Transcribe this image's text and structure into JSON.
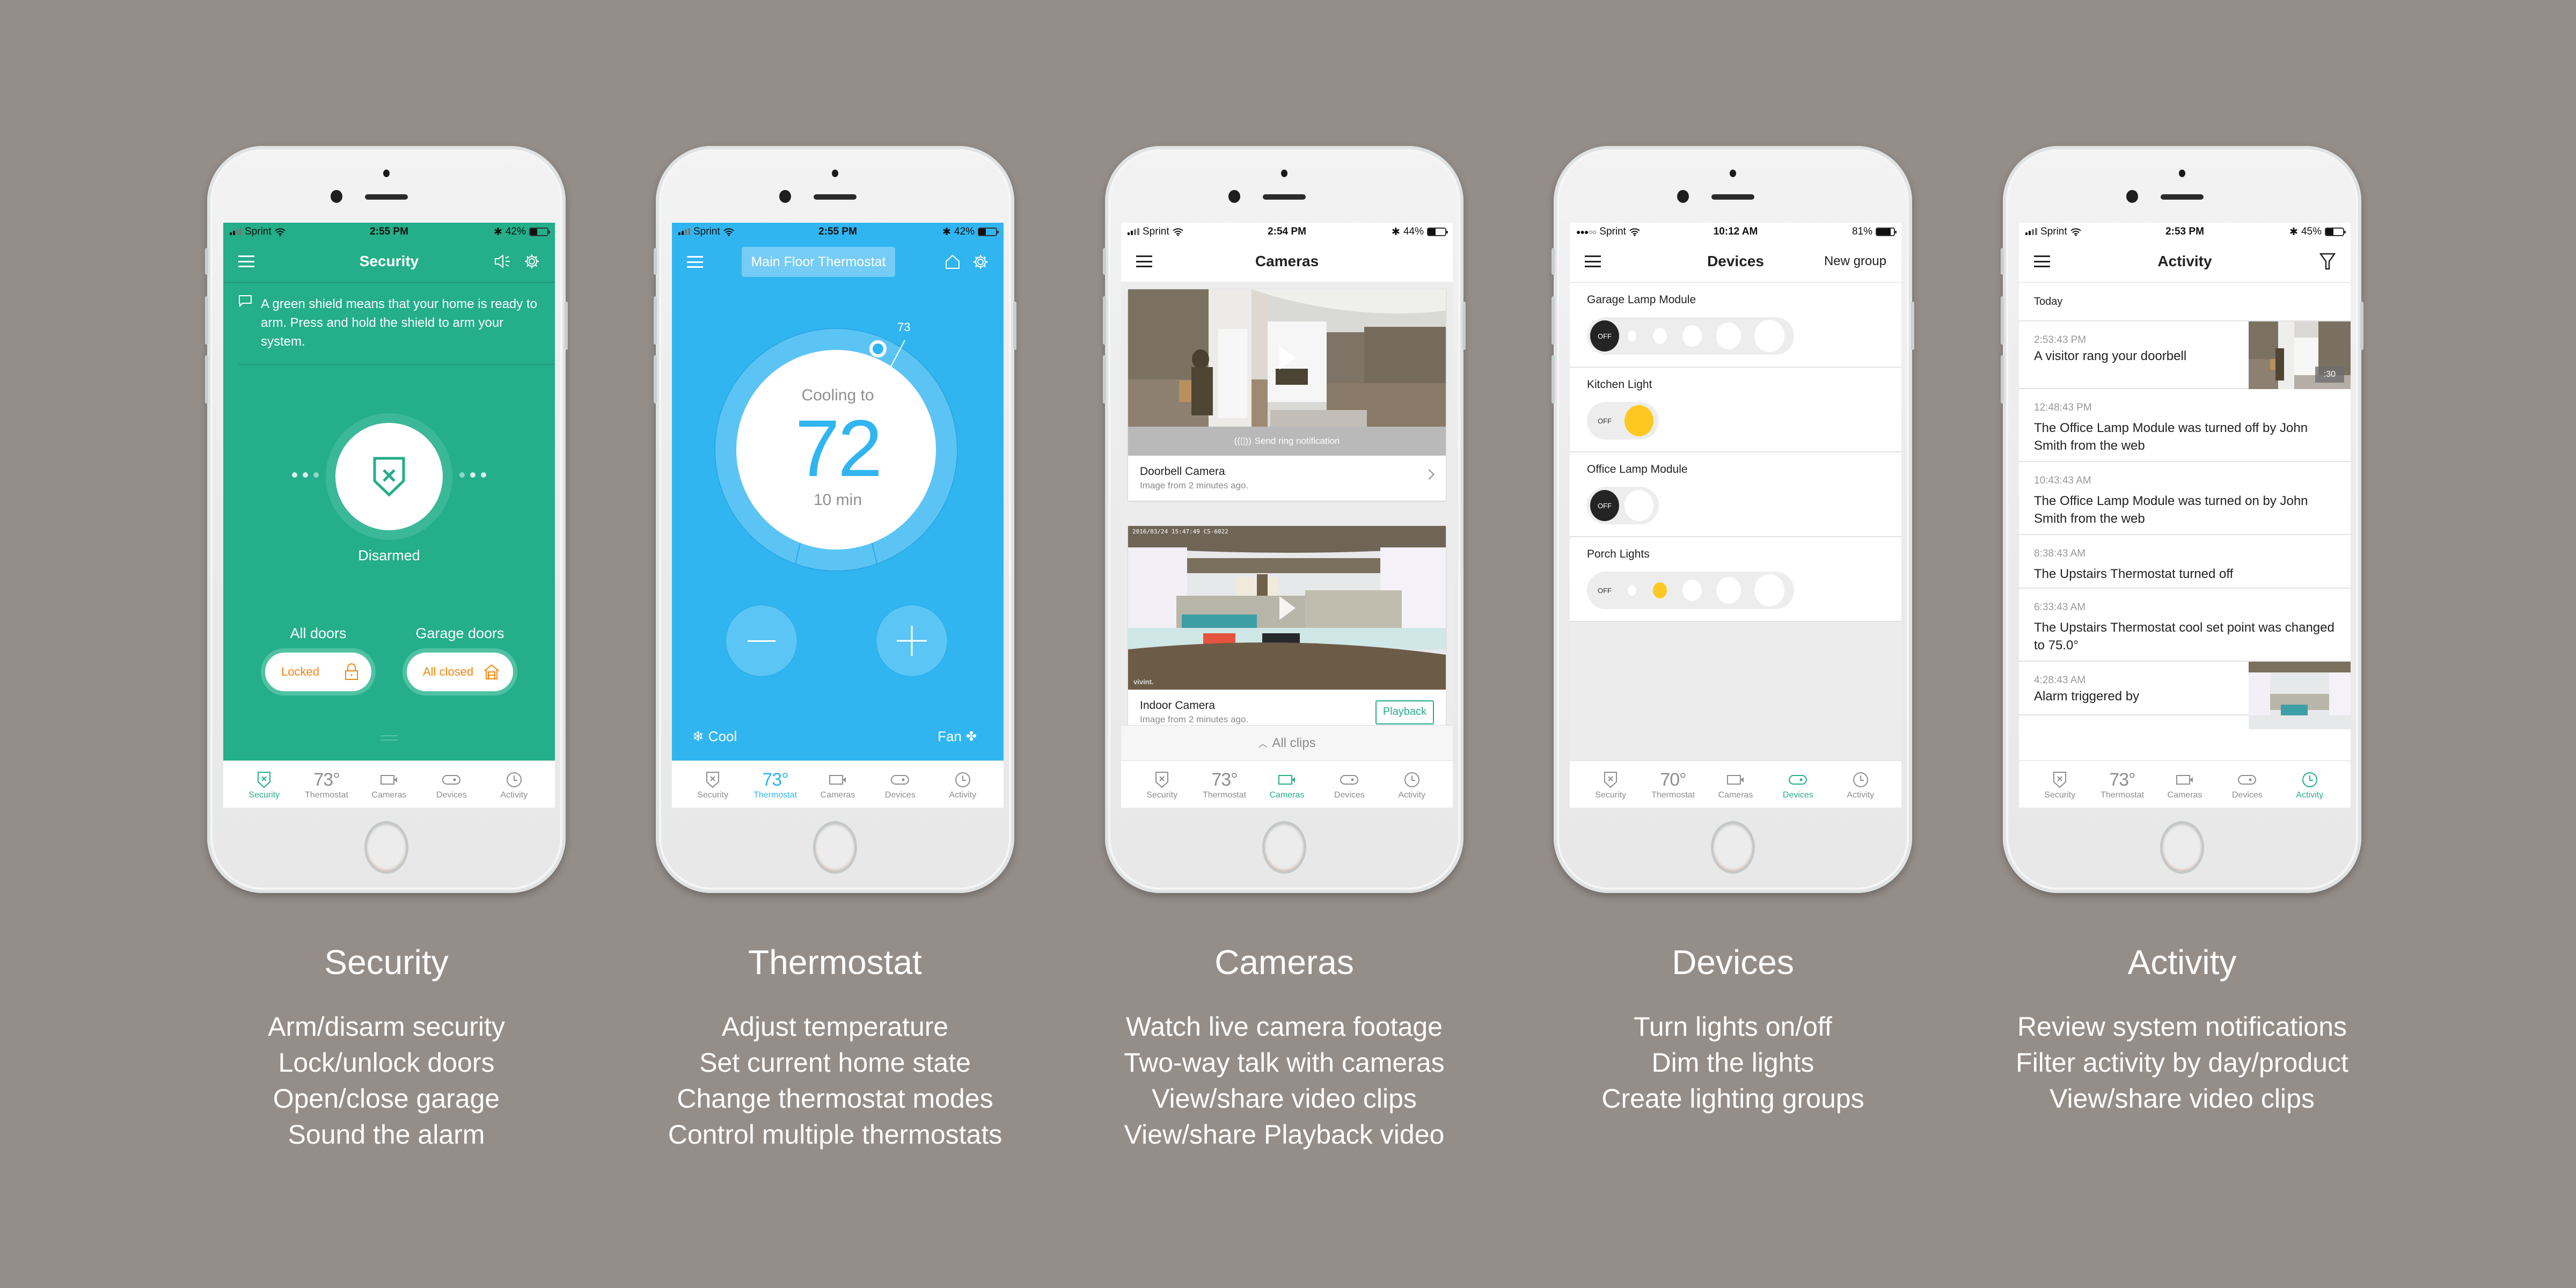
{
  "colors": {
    "background": "#958d88",
    "security_green": "#24ae8a",
    "thermostat_blue": "#31b5f1",
    "accent_orange": "#f6850b",
    "dimmer_yellow": "#fdc822",
    "tab_inactive": "#8e8e8e"
  },
  "tabbar_labels": [
    "Security",
    "Thermostat",
    "Cameras",
    "Devices",
    "Activity"
  ],
  "panels": [
    {
      "caption": {
        "title": "Security",
        "features": [
          "Arm/disarm security",
          "Lock/unlock doors",
          "Open/close garage",
          "Sound the alarm"
        ]
      },
      "status": {
        "carrier": "Sprint",
        "time": "2:55 PM",
        "battery": "42%",
        "battery_level": 0.42,
        "bluetooth": true
      },
      "header": {
        "title": "Security",
        "icons": [
          "menu-icon",
          "panic-alarm-icon",
          "gear-icon"
        ]
      },
      "hint": "A green shield means that your home is ready to arm. Press and hold the shield to arm your system.",
      "arm_state": "Disarmed",
      "doors": [
        {
          "label": "All doors",
          "status": "Locked",
          "icon": "lock-icon"
        },
        {
          "label": "Garage doors",
          "status": "All closed",
          "icon": "garage-icon"
        }
      ],
      "tabbar": {
        "thermostat_temp": "73°",
        "active": "Security"
      }
    },
    {
      "caption": {
        "title": "Thermostat",
        "features": [
          "Adjust temperature",
          "Set current home state",
          "Change thermostat modes",
          "Control multiple thermostats"
        ]
      },
      "status": {
        "carrier": "Sprint",
        "time": "2:55 PM",
        "battery": "42%",
        "battery_level": 0.42,
        "bluetooth": true
      },
      "header": {
        "title": "Main Floor Thermostat",
        "icons": [
          "menu-icon",
          "home-icon",
          "gear-icon"
        ]
      },
      "dial": {
        "label": "Cooling to",
        "setpoint": "72",
        "eta": "10 min",
        "current_temp": "73"
      },
      "mode": "Cool",
      "fan": "Fan",
      "tabbar": {
        "thermostat_temp": "73°",
        "active": "Thermostat"
      }
    },
    {
      "caption": {
        "title": "Cameras",
        "features": [
          "Watch live camera footage",
          "Two-way talk with cameras",
          "View/share video clips",
          "View/share Playback video"
        ]
      },
      "status": {
        "carrier": "Sprint",
        "time": "2:54 PM",
        "battery": "44%",
        "battery_level": 0.44,
        "bluetooth": true
      },
      "header": {
        "title": "Cameras"
      },
      "cameras": [
        {
          "name": "Doorbell Camera",
          "subtitle": "Image from 2 minutes ago.",
          "action": "Send ring notification"
        },
        {
          "name": "Indoor Camera",
          "subtitle": "Image from 2 minutes ago.",
          "button": "Playback",
          "overlay_timestamp": "2016/03/24 15:47:49 CS-6022",
          "watermark": "vivint."
        }
      ],
      "all_clips": "All clips",
      "tabbar": {
        "thermostat_temp": "73°",
        "active": "Cameras"
      }
    },
    {
      "caption": {
        "title": "Devices",
        "features": [
          "Turn lights on/off",
          "Dim the lights",
          "Create lighting groups"
        ]
      },
      "status": {
        "carrier": "Sprint",
        "time": "10:12 AM",
        "battery": "81%",
        "battery_level": 0.81,
        "bluetooth": false
      },
      "header": {
        "title": "Devices",
        "action": "New group"
      },
      "devices": [
        {
          "name": "Garage Lamp Module",
          "type": "dimmer",
          "levels": 5,
          "level": 0,
          "off_label": "OFF"
        },
        {
          "name": "Kitchen Light",
          "type": "switch",
          "on": true,
          "off_label": "OFF"
        },
        {
          "name": "Office Lamp Module",
          "type": "switch",
          "on": false,
          "off_label": "OFF"
        },
        {
          "name": "Porch Lights",
          "type": "dimmer",
          "levels": 5,
          "level": 2,
          "off_label": "OFF"
        }
      ],
      "tabbar": {
        "thermostat_temp": "70°",
        "active": "Devices"
      }
    },
    {
      "caption": {
        "title": "Activity",
        "features": [
          "Review system notifications",
          "Filter activity by day/product",
          "View/share video clips"
        ]
      },
      "status": {
        "carrier": "Sprint",
        "time": "2:53 PM",
        "battery": "45%",
        "battery_level": 0.45,
        "bluetooth": true
      },
      "header": {
        "title": "Activity",
        "icons": [
          "menu-icon",
          "filter-icon"
        ]
      },
      "day": "Today",
      "items": [
        {
          "time": "2:53:43 PM",
          "message": "A visitor rang your doorbell",
          "thumb": "doorbell",
          "duration": ":30"
        },
        {
          "time": "12:48:43 PM",
          "message": "The Office Lamp Module was turned off by John Smith from the web"
        },
        {
          "time": "10:43:43 AM",
          "message": "The Office Lamp Module was turned on by John Smith from the web"
        },
        {
          "time": "8:38:43 AM",
          "message": "The Upstairs Thermostat turned off"
        },
        {
          "time": "6:33:43 AM",
          "message": "The Upstairs Thermostat cool set point was changed to 75.0°"
        },
        {
          "time": "4:28:43 AM",
          "message": "Alarm triggered by",
          "thumb": "indoor"
        }
      ],
      "tabbar": {
        "thermostat_temp": "73°",
        "active": "Activity"
      }
    }
  ]
}
